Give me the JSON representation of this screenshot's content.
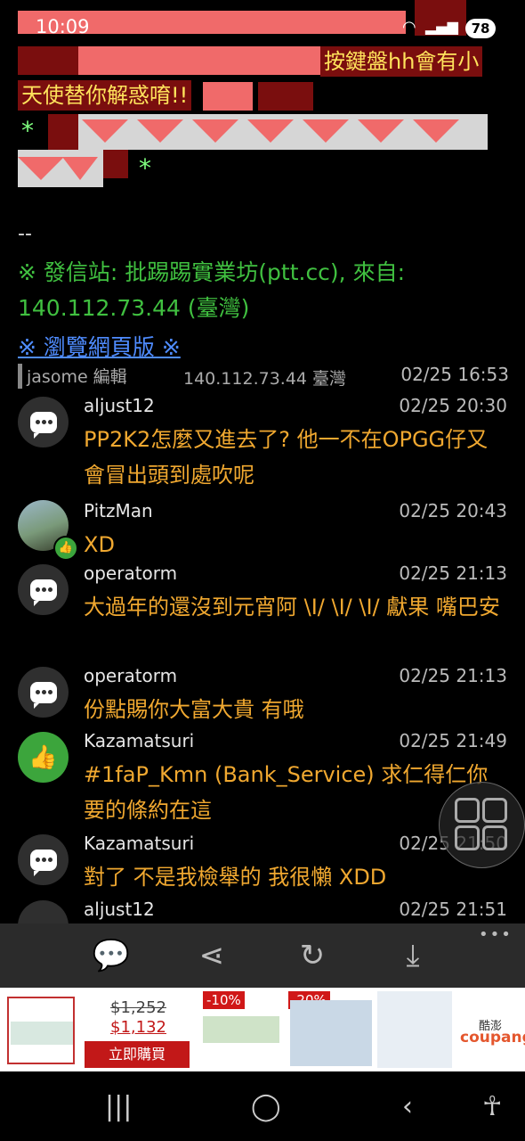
{
  "status": {
    "time": "10:09",
    "battery": "78"
  },
  "banner": {
    "line1": "按鍵盤hh會有小",
    "line2": "天使替你解惑唷!!",
    "star": "*"
  },
  "signature": {
    "dash": "--",
    "line": "※ 發信站: 批踢踢實業坊(ptt.cc), 來自: 140.112.73.44 (臺灣)",
    "link": "※ 瀏覽網頁版 ※"
  },
  "edit": {
    "user": "jasome 編輯",
    "ip": "140.112.73.44 臺灣",
    "time": "02/25 16:53"
  },
  "comments": [
    {
      "author": "aljust12",
      "time": "02/25 20:30",
      "text": "PP2K2怎麼又進去了? 他一不在OPGG仔又會冒出頭到處吹呢",
      "icon": "comment-icon"
    },
    {
      "author": "PitzMan",
      "time": "02/25 20:43",
      "text": "XD",
      "icon": "user-avatar"
    },
    {
      "author": "operatorm",
      "time": "02/25 21:13",
      "text": "大過年的還沒到元宵阿  \\I/   \\I/    \\I/ 獻果 嘴巴安",
      "icon": "comment-icon"
    },
    {
      "author": "operatorm",
      "time": "02/25 21:13",
      "text": "份點賜你大富大貴 有哦",
      "icon": "comment-icon"
    },
    {
      "author": "Kazamatsuri",
      "time": "02/25 21:49",
      "text": "#1faP_Kmn (Bank_Service) 求仁得仁你要的條約在這",
      "icon": "thumbs-up-icon"
    },
    {
      "author": "Kazamatsuri",
      "time": "02/25 21:50",
      "text": "對了 不是我檢舉的 我很懶 XDD",
      "icon": "comment-icon"
    },
    {
      "author": "aljust12",
      "time": "02/25 21:51",
      "text": "",
      "icon": "comment-icon"
    }
  ],
  "toolbar": {
    "more": "•••"
  },
  "ad": {
    "old_price": "$1,252",
    "new_price": "$1,132",
    "buy": "立即購買",
    "tag1": "-10%",
    "tag2": "-20%",
    "brand_sub": "酷澎",
    "brand": "coupang"
  }
}
